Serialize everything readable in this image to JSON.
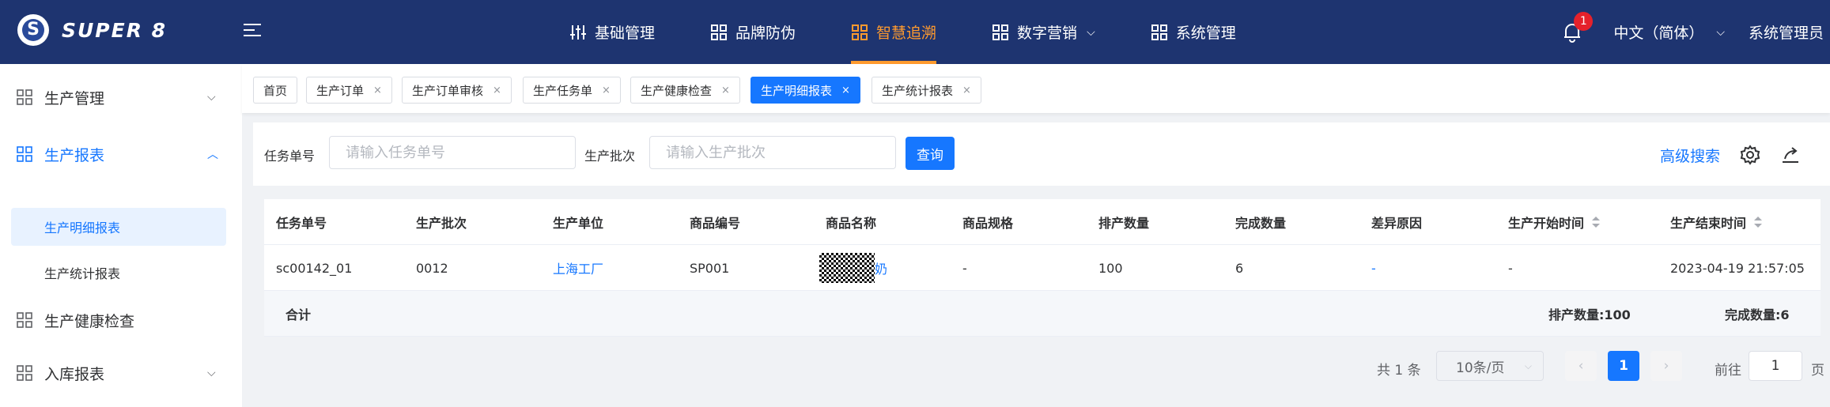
{
  "header": {
    "logo_text": "SUPER 8",
    "nav": [
      {
        "label": "基础管理",
        "icon": "sliders-icon"
      },
      {
        "label": "品牌防伪",
        "icon": "grid-icon"
      },
      {
        "label": "智慧追溯",
        "icon": "grid-icon",
        "active": true
      },
      {
        "label": "数字营销",
        "icon": "grid-icon",
        "has_dropdown": true
      },
      {
        "label": "系统管理",
        "icon": "grid-icon"
      }
    ],
    "notification_count": "1",
    "language": "中文（简体）",
    "user": "系统管理员",
    "accent_color": "#ff9a2e",
    "bg_color": "#1e3470"
  },
  "sidebar": {
    "groups": [
      {
        "label": "生产管理",
        "expanded": false
      },
      {
        "label": "生产报表",
        "expanded": true,
        "children": [
          {
            "label": "生产明细报表",
            "active": true
          },
          {
            "label": "生产统计报表"
          }
        ]
      },
      {
        "label": "生产健康检查",
        "expanded": false
      },
      {
        "label": "入库报表",
        "expanded": false
      }
    ]
  },
  "tabs": [
    {
      "label": "首页",
      "closable": false
    },
    {
      "label": "生产订单",
      "closable": true
    },
    {
      "label": "生产订单审核",
      "closable": true
    },
    {
      "label": "生产任务单",
      "closable": true
    },
    {
      "label": "生产健康检查",
      "closable": true
    },
    {
      "label": "生产明细报表",
      "closable": true,
      "active": true
    },
    {
      "label": "生产统计报表",
      "closable": true
    }
  ],
  "tab_close_glyph": "×",
  "filter": {
    "task_no_label": "任务单号",
    "task_no_placeholder": "请输入任务单号",
    "task_no_value": "",
    "batch_label": "生产批次",
    "batch_placeholder": "请输入生产批次",
    "batch_value": "",
    "query_button": "查询",
    "advanced_search": "高级搜索"
  },
  "table": {
    "columns": [
      "任务单号",
      "生产批次",
      "生产单位",
      "商品编号",
      "商品名称",
      "商品规格",
      "排产数量",
      "完成数量",
      "差异原因",
      "生产开始时间",
      "生产结束时间"
    ],
    "rows": [
      {
        "task_no": "sc00142_01",
        "batch": "0012",
        "unit": "上海工厂",
        "product_code": "SP001",
        "product_name_suffix": "奶",
        "spec": "-",
        "planned_qty": "100",
        "done_qty": "6",
        "diff_reason": "-",
        "start_time": "-",
        "end_time": "2023-04-19 21:57:05"
      }
    ],
    "summary": {
      "label": "合计",
      "planned": "排产数量:100",
      "done": "完成数量:6"
    }
  },
  "pagination": {
    "total": "共 1 条",
    "page_size": "10条/页",
    "current_page": "1",
    "goto_label": "前往",
    "goto_value": "1",
    "page_suffix": "页"
  }
}
